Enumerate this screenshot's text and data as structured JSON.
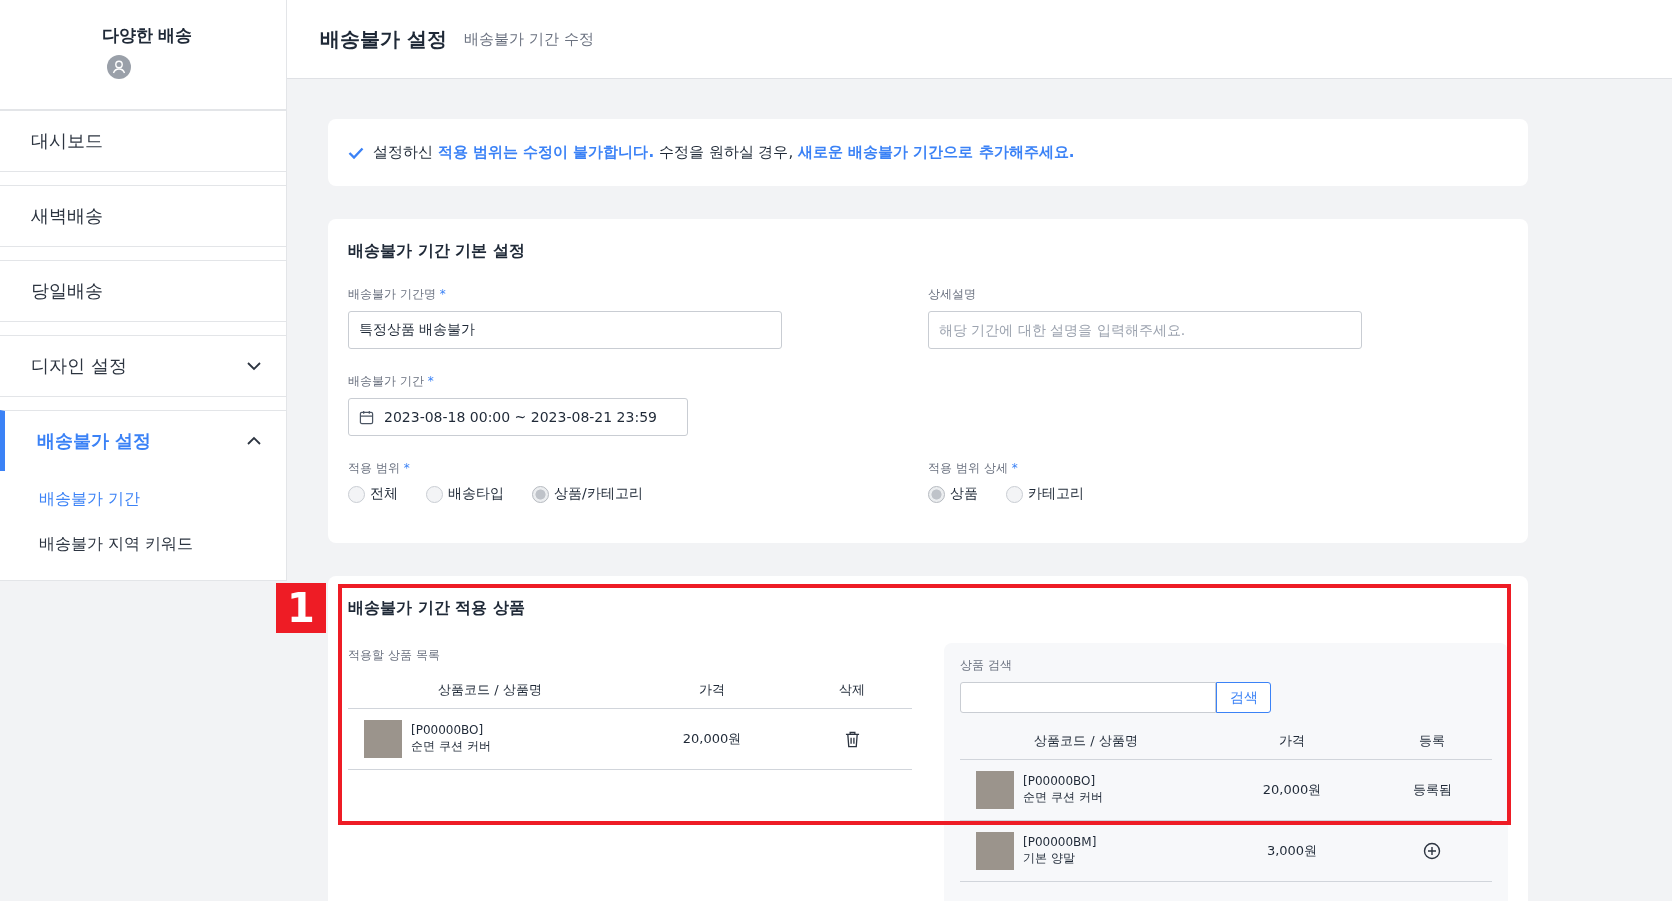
{
  "sidebar": {
    "brand": "다양한 배송",
    "items": [
      {
        "label": "대시보드",
        "kind": "link",
        "selected": false
      },
      {
        "label": "새벽배송",
        "kind": "link",
        "selected": false
      },
      {
        "label": "당일배송",
        "kind": "link",
        "selected": false
      },
      {
        "label": "디자인 설정",
        "kind": "group",
        "selected": false,
        "expanded": false
      },
      {
        "label": "배송불가 설정",
        "kind": "group",
        "selected": true,
        "expanded": true,
        "children": [
          {
            "label": "배송불가 기간",
            "selected": true
          },
          {
            "label": "배송불가 지역 키워드",
            "selected": false
          }
        ]
      }
    ]
  },
  "header": {
    "title": "배송불가 설정",
    "subtitle": "배송불가 기간 수정"
  },
  "notice": "설정하신 **적용 범위는 수정이 불가합니다.** 수정을 원하실 경우, **새로운 배송불가 기간으로 추가해주세요.**",
  "basic_settings": {
    "title": "배송불가 기간 기본 설정",
    "name_field": {
      "label": "배송불가 기간명",
      "required_mark": "*",
      "value": "특정상품 배송불가"
    },
    "description_field": {
      "label": "상세설명",
      "placeholder": "해당 기간에 대한 설명을 입력해주세요."
    },
    "period_field": {
      "label": "배송불가 기간",
      "required_mark": "*",
      "value": "2023-08-18 00:00 ~ 2023-08-21 23:59"
    },
    "scope": {
      "label": "적용 범위",
      "required_mark": "*",
      "options": [
        {
          "label": "전체",
          "selected": false
        },
        {
          "label": "배송타입",
          "selected": false
        },
        {
          "label": "상품/카테고리",
          "selected": true
        }
      ]
    },
    "scope_detail": {
      "label": "적용 범위 상세",
      "required_mark": "*",
      "options": [
        {
          "label": "상품",
          "selected": true
        },
        {
          "label": "카테고리",
          "selected": false
        }
      ]
    }
  },
  "products": {
    "title": "배송불가 기간 적용 상품",
    "annotation": "1",
    "applied": {
      "label": "적용할 상품 목록",
      "columns": [
        "상품코드 / 상품명",
        "가격",
        "삭제"
      ],
      "rows": [
        {
          "code": "[P00000BO]",
          "name": "순면 쿠션 커버",
          "price": "20,000원"
        }
      ]
    },
    "search": {
      "label": "상품 검색",
      "button": "검색",
      "columns": [
        "상품코드 / 상품명",
        "가격",
        "등록"
      ],
      "rows": [
        {
          "code": "[P00000BO]",
          "name": "순면 쿠션 커버",
          "price": "20,000원",
          "registered": true,
          "status": "등록됨"
        },
        {
          "code": "[P00000BM]",
          "name": "기본 양말",
          "price": "3,000원",
          "registered": false
        }
      ]
    }
  }
}
